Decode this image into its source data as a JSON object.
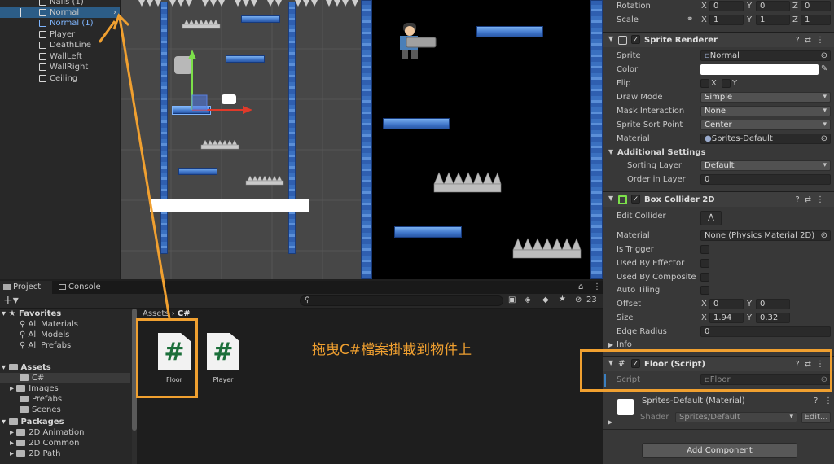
{
  "hierarchy": {
    "items": [
      {
        "label": "Nails (1)",
        "state": "normal"
      },
      {
        "label": "Normal",
        "state": "selected"
      },
      {
        "label": "Normal (1)",
        "state": "blue"
      },
      {
        "label": "Player",
        "state": "normal"
      },
      {
        "label": "DeathLine",
        "state": "normal"
      },
      {
        "label": "WallLeft",
        "state": "normal"
      },
      {
        "label": "WallRight",
        "state": "normal"
      },
      {
        "label": "Ceiling",
        "state": "normal"
      }
    ]
  },
  "inspector": {
    "transform": {
      "rotation_label": "Rotation",
      "rotation": {
        "x": "0",
        "y": "0",
        "z": "0"
      },
      "scale_label": "Scale",
      "scale": {
        "x": "1",
        "y": "1",
        "z": "1"
      },
      "axis_x": "X",
      "axis_y": "Y",
      "axis_z": "Z"
    },
    "sprite_renderer": {
      "title": "Sprite Renderer",
      "sprite_label": "Sprite",
      "sprite_value": "Normal",
      "color_label": "Color",
      "flip_label": "Flip",
      "flip_x": "X",
      "flip_y": "Y",
      "draw_mode_label": "Draw Mode",
      "draw_mode": "Simple",
      "mask_label": "Mask Interaction",
      "mask": "None",
      "sort_point_label": "Sprite Sort Point",
      "sort_point": "Center",
      "material_label": "Material",
      "material": "Sprites-Default",
      "additional_label": "Additional Settings",
      "sorting_layer_label": "Sorting Layer",
      "sorting_layer": "Default",
      "order_label": "Order in Layer",
      "order": "0"
    },
    "box_collider": {
      "title": "Box Collider 2D",
      "edit_label": "Edit Collider",
      "material_label": "Material",
      "material": "None (Physics Material 2D)",
      "trigger_label": "Is Trigger",
      "effector_label": "Used By Effector",
      "composite_label": "Used By Composite",
      "tiling_label": "Auto Tiling",
      "offset_label": "Offset",
      "offset": {
        "x": "0",
        "y": "0"
      },
      "size_label": "Size",
      "size": {
        "x": "1.94",
        "y": "0.32"
      },
      "edge_label": "Edge Radius",
      "edge": "0",
      "info_label": "Info"
    },
    "floor_script": {
      "title": "Floor (Script)",
      "script_label": "Script",
      "script_value": "Floor"
    },
    "material_block": {
      "title": "Sprites-Default (Material)",
      "shader_label": "Shader",
      "shader_value": "Sprites/Default",
      "edit_label": "Edit..."
    },
    "add_component": "Add Component"
  },
  "project": {
    "tabs": [
      "Project",
      "Console"
    ],
    "hidden_count": "23",
    "breadcrumb": {
      "root": "Assets",
      "current": "C#"
    },
    "tree": {
      "favorites": "Favorites",
      "fav_items": [
        "All Materials",
        "All Models",
        "All Prefabs"
      ],
      "assets": "Assets",
      "asset_folders": [
        "C#",
        "Images",
        "Prefabs",
        "Scenes"
      ],
      "packages": "Packages",
      "package_folders": [
        "2D Animation",
        "2D Common",
        "2D Path"
      ]
    },
    "files": [
      {
        "name": "Floor",
        "glyph": "#"
      },
      {
        "name": "Player",
        "glyph": "#"
      }
    ]
  },
  "annotation": "拖曳C#檔案掛載到物件上",
  "colors": {
    "highlight": "#f0a030",
    "selection": "#2c5d87",
    "csharp": "#1b6f3a"
  }
}
